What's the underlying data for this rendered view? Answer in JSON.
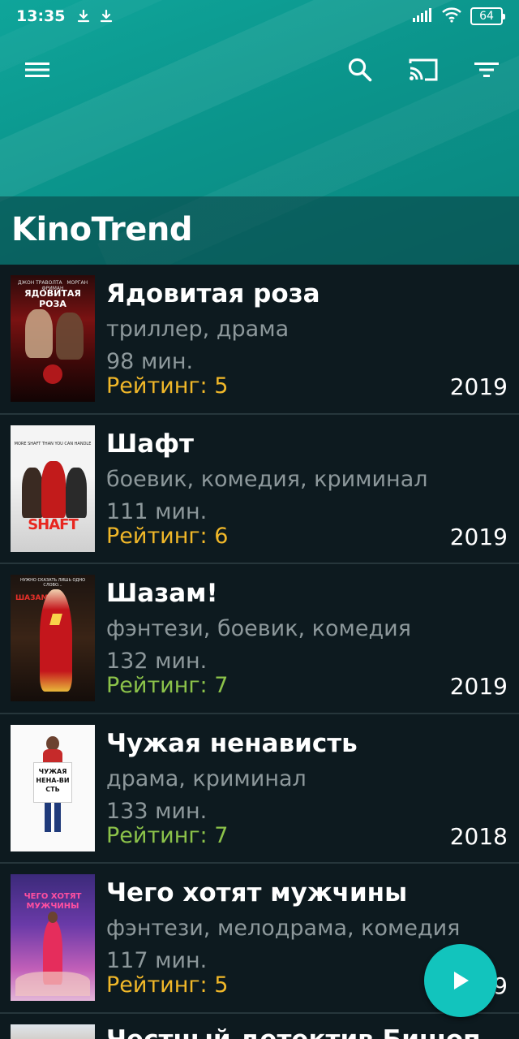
{
  "status_bar": {
    "time": "13:35",
    "battery": "64",
    "icons": [
      "download-icon",
      "download-icon",
      "signal-icon",
      "wifi-icon",
      "battery-icon"
    ]
  },
  "toolbar": {
    "icons": [
      "menu-icon",
      "search-icon",
      "cast-icon",
      "filter-icon"
    ]
  },
  "app": {
    "title": "KinoTrend",
    "accent": "#0fa59a",
    "fab_color": "#12c4bd",
    "fab_icon": "play-icon"
  },
  "movies": [
    {
      "title": "Ядовитая роза",
      "genres": "триллер, драма",
      "duration": "98  мин.",
      "rating": "Рейтинг:  5",
      "year": "2019",
      "poster_text": "ЯДОВИТАЯ РОЗА",
      "rating_color": "#f1b829"
    },
    {
      "title": "Шафт",
      "genres": "боевик, комедия, криминал",
      "duration": "111  мин.",
      "rating": "Рейтинг:  6",
      "year": "2019",
      "poster_text": "SHAFT",
      "rating_color": "#f1b829"
    },
    {
      "title": "Шазам!",
      "genres": "фэнтези, боевик, комедия",
      "duration": "132  мин.",
      "rating": "Рейтинг:  7",
      "year": "2019",
      "poster_text": "ШАЗАМ!",
      "rating_color": "#8cc34a"
    },
    {
      "title": "Чужая ненависть",
      "genres": "драма, криминал",
      "duration": "133  мин.",
      "rating": "Рейтинг:  7",
      "year": "2018",
      "poster_text": "ЧУЖАЯ НЕНА-ВИСТЬ",
      "rating_color": "#8cc34a"
    },
    {
      "title": "Чего хотят мужчины",
      "genres": "фэнтези, мелодрама, комедия",
      "duration": "117  мин.",
      "rating": "Рейтинг:  5",
      "year": "2019",
      "poster_text": "ЧЕГО ХОТЯТ МУЖЧИНЫ",
      "rating_color": "#f1b829"
    },
    {
      "title": "Честный детектив Бишоп...",
      "partial": true
    }
  ]
}
